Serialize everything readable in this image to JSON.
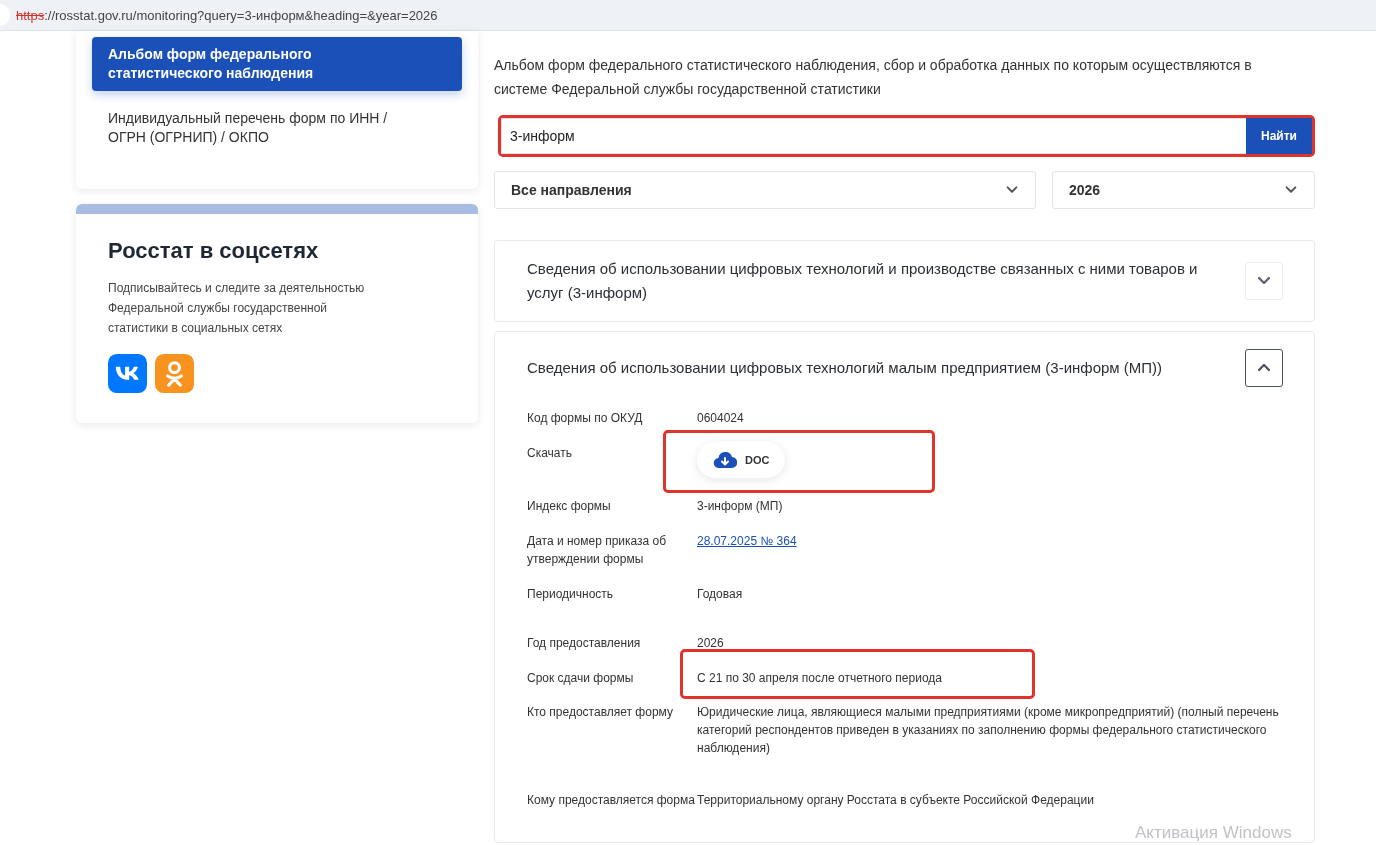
{
  "address_bar": {
    "scheme": "https",
    "insecure": true,
    "rest": "://rosstat.gov.ru/monitoring?query=3-информ&heading=&year=2026"
  },
  "sidebar": {
    "items": [
      {
        "label": "Альбом форм федерального статистического наблюдения",
        "selected": true
      },
      {
        "label": "Индивидуальный перечень форм по ИНН / ОГРН (ОГРНИП) / ОКПО",
        "selected": false
      }
    ]
  },
  "social": {
    "title": "Росстат в соцсетях",
    "text": "Подписывайтесь и следите за деятельностью Федеральной службы государственной статистики в социальных сетях",
    "links": [
      {
        "kind": "vk"
      },
      {
        "kind": "ok"
      }
    ]
  },
  "intro": "Альбом форм федерального статистического наблюдения, сбор и обработка данных по которым осуществляются в системе Федеральной службы государственной статистики",
  "search": {
    "value": "3-информ",
    "button": "Найти",
    "highlighted": true
  },
  "filters": [
    {
      "value": "Все направления"
    },
    {
      "value": "2026"
    }
  ],
  "forms": [
    {
      "title": "Сведения об использовании цифровых технологий и производстве связанных с ними товаров и услуг (3-информ)",
      "expanded": false
    },
    {
      "title": "Сведения об использовании цифровых технологий малым предприятием (3-информ (МП))",
      "expanded": true,
      "details": [
        {
          "label": "Код формы по ОКУД",
          "kind": "text",
          "value": "0604024",
          "highlighted": false
        },
        {
          "label": "Скачать",
          "kind": "download",
          "value": "DOC",
          "highlighted": true
        },
        {
          "label": "Индекс формы",
          "kind": "text",
          "value": "3-информ (МП)",
          "highlighted": false
        },
        {
          "label": "Дата и номер приказа об утверждении формы",
          "kind": "link",
          "value": "28.07.2025 № 364",
          "highlighted": false
        },
        {
          "label": "Периодичность",
          "kind": "text",
          "value": "Годовая",
          "highlighted": false
        },
        {
          "label": "Год предоставления",
          "kind": "text",
          "value": "2026",
          "highlighted": false
        },
        {
          "label": "Срок сдачи формы",
          "kind": "text",
          "value": "С 21 по 30 апреля после отчетного периода",
          "highlighted": true
        },
        {
          "label": "Кто предоставляет форму",
          "kind": "text",
          "value": "Юридические лица, являющиеся малыми предприятиями (кроме микропредприятий) (полный перечень категорий респондентов приведен в указаниях по заполнению формы федерального статистического наблюдения)",
          "highlighted": false
        },
        {
          "label": "Кому предоставляется форма",
          "kind": "text",
          "value": "Территориальному органу Росстата в субъекте Российской Федерации",
          "highlighted": false
        }
      ]
    }
  ],
  "os_overlay": {
    "text": "Активация Windows"
  }
}
